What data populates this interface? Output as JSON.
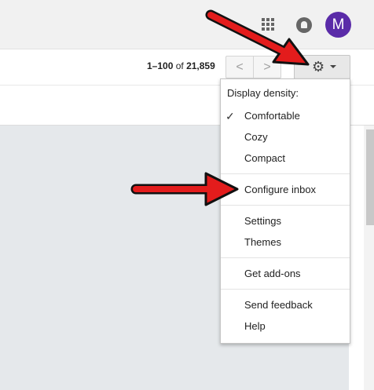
{
  "header": {
    "avatar_initial": "M",
    "icons": [
      "apps-grid-icon",
      "notifications-icon"
    ]
  },
  "toolbar": {
    "range_text": "1–100",
    "of_text": "of",
    "total_text": "21,859",
    "prev_symbol": "<",
    "next_symbol": ">",
    "settings_icon": "gear-icon"
  },
  "menu": {
    "density_heading": "Display density:",
    "density_options": [
      {
        "label": "Comfortable",
        "checked": true
      },
      {
        "label": "Cozy",
        "checked": false
      },
      {
        "label": "Compact",
        "checked": false
      }
    ],
    "configure_inbox": "Configure inbox",
    "settings": "Settings",
    "themes": "Themes",
    "get_addons": "Get add-ons",
    "send_feedback": "Send feedback",
    "help": "Help",
    "check_glyph": "✓"
  },
  "annotations": {
    "arrow_color": "#e31c1c",
    "arrow_outline": "#111111"
  }
}
